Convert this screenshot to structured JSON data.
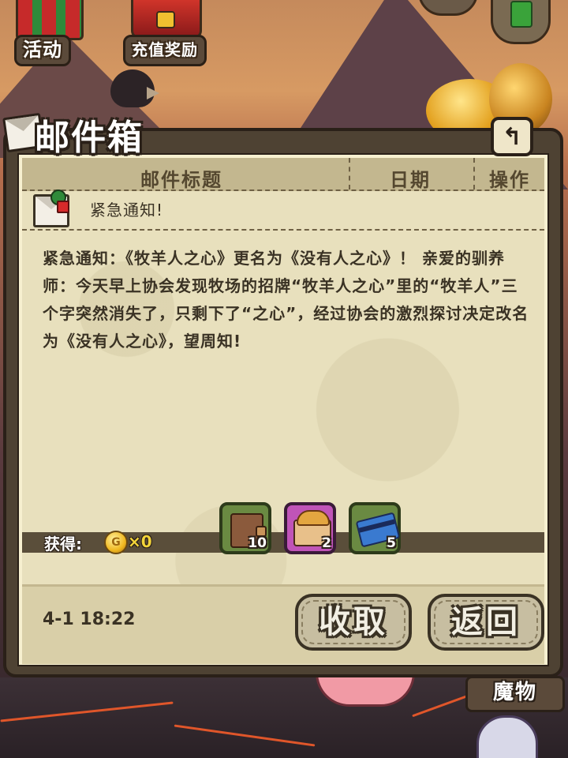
{
  "top_nav": {
    "activity_label": "活动",
    "recharge_label": "充值奖励"
  },
  "mailbox": {
    "title": "邮件箱",
    "back_icon": "↰",
    "columns": [
      "邮件标题",
      "日期",
      "操作"
    ],
    "mail": {
      "subject": "紧急通知!",
      "body": "紧急通知：《牧羊人之心》更名为《没有人之心》！ 亲爱的驯养师：今天早上协会发现牧场的招牌“牧羊人之心”里的“牧羊人”三个字突然消失了，只剩下了“之心”，经过协会的激烈探讨决定改名为《没有人之心》，望周知!",
      "reward_label": "获得:",
      "coin_symbol": "G",
      "coin_count": "×0",
      "items": [
        {
          "icon": "wallet-icon",
          "count": "10",
          "rarity": "green"
        },
        {
          "icon": "bread-basket-icon",
          "count": "2",
          "rarity": "purple"
        },
        {
          "icon": "blue-card-icon",
          "count": "5",
          "rarity": "green"
        }
      ],
      "date": "4-1 18:22"
    },
    "claim_button": "收取",
    "return_button": "返回"
  },
  "bottom_nav": {
    "monster_label": "魔物"
  },
  "colors": {
    "panel_border": "#4e4233",
    "paper": "#e8e0bd",
    "button_face": "#c7bea1",
    "coin_text": "#f3d43a"
  }
}
